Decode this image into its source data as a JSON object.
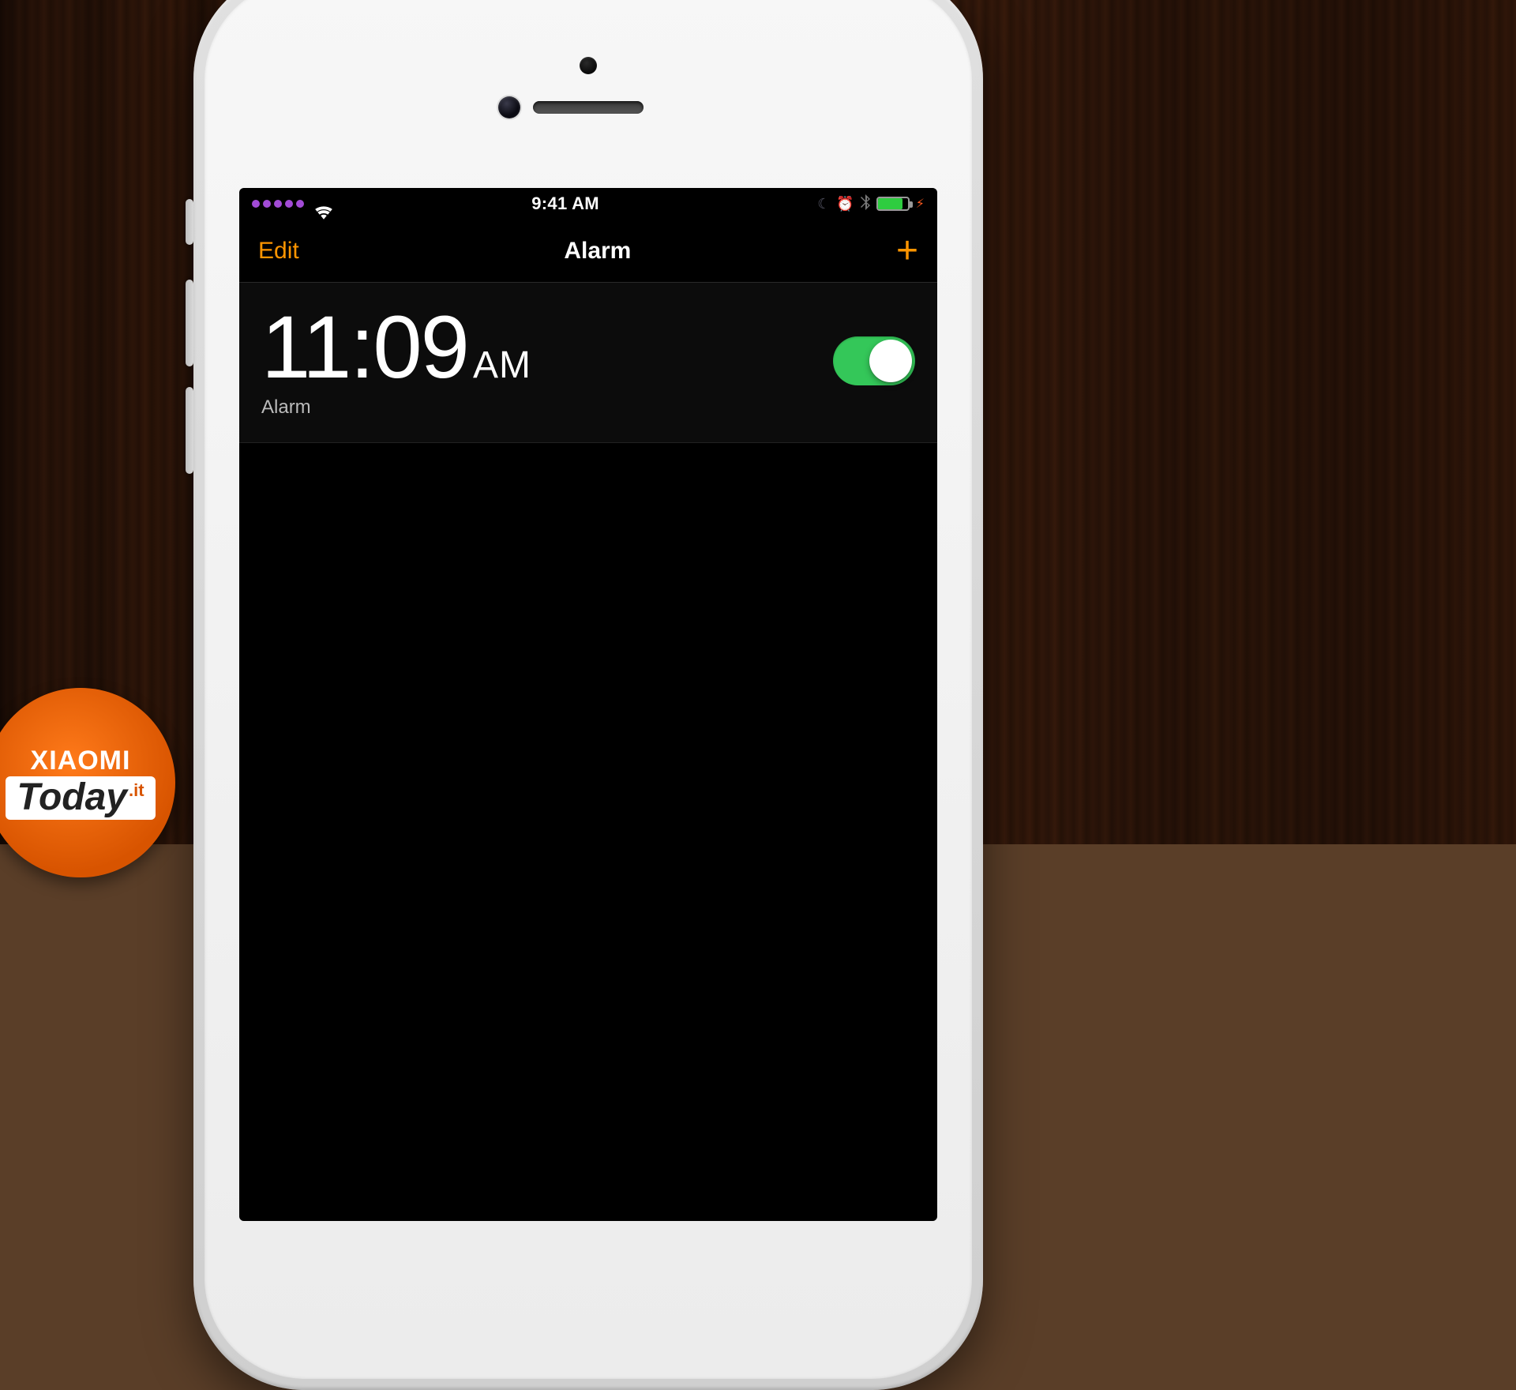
{
  "statusBar": {
    "time": "9:41 AM",
    "signalDots": 5,
    "icons": {
      "wifi": "wifi",
      "dnd": "moon",
      "alarm": "alarm-clock",
      "bluetooth": "bluetooth",
      "charging": "bolt"
    },
    "batteryPercent": 82
  },
  "navBar": {
    "leftButton": "Edit",
    "title": "Alarm",
    "rightButtonGlyph": "+"
  },
  "alarms": [
    {
      "time": "11:09",
      "ampm": "AM",
      "label": "Alarm",
      "enabled": true
    }
  ],
  "watermark": {
    "line1": "XIAOMI",
    "line2": "Today",
    "tld": ".it"
  },
  "colors": {
    "accent": "#ff9500",
    "switchOn": "#34c759",
    "batteryFill": "#2ecc40"
  }
}
